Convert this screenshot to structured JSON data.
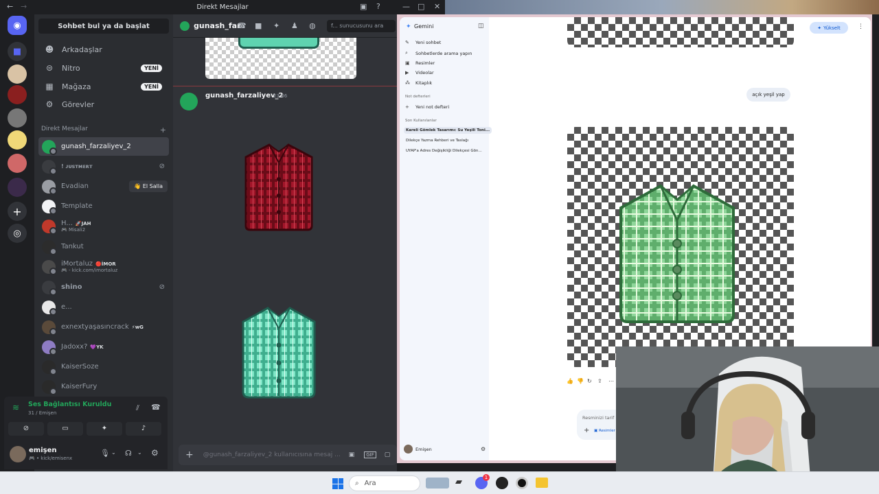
{
  "discord": {
    "window_title": "Direkt Mesajlar",
    "find_conversation": "Sohbet bul ya da başlat",
    "nav": [
      {
        "label": "Arkadaşlar",
        "icon": "friends-icon"
      },
      {
        "label": "Nitro",
        "icon": "nitro-icon",
        "badge": "YENİ"
      },
      {
        "label": "Mağaza",
        "icon": "shop-icon",
        "badge": "YENİ"
      },
      {
        "label": "Görevler",
        "icon": "quests-icon"
      }
    ],
    "dm_header": "Direkt Mesajlar",
    "dm_list": [
      {
        "name": "gunash_farzaliyev_2",
        "color": "#23a55a"
      },
      {
        "name": "! ᴊᴜsᴛᴍᴇʀᴛ",
        "color": "#3a3c40"
      },
      {
        "name": "Evadian",
        "color": "#9a9da3",
        "action": "👋 El Salla"
      },
      {
        "name": "Template",
        "color": "#f2f3f5"
      },
      {
        "name": "H...",
        "tag": "🚀JAH",
        "sub": "🎮 Misali2",
        "color": "#c0392b"
      },
      {
        "name": "Tankut",
        "color": "#2c2c2c"
      },
      {
        "name": "iMortaluz",
        "tag": "🔴İMOR",
        "sub": "🎮 - kick.com/imortaluz",
        "color": "#4a4a4a"
      },
      {
        "name": "shino",
        "color": "#3a3c40"
      },
      {
        "name": "e...",
        "color": "#e8e8e8"
      },
      {
        "name": "exnextyaşasıncrack",
        "tag": "⚡wG",
        "color": "#5a4a3a"
      },
      {
        "name": "Jadoxx?",
        "tag": "💜YK",
        "color": "#8e7cc3"
      },
      {
        "name": "KaiserSoze",
        "color": "#2a2a2a"
      },
      {
        "name": "KaiserFury",
        "color": "#2a2a2a"
      }
    ],
    "voice": {
      "status": "Ses Bağlantısı Kuruldu",
      "server": "31 / Emişen"
    },
    "user": {
      "name": "emişen",
      "status": "🎮 • kick/emisenx"
    },
    "chat": {
      "channel": "gunash_far",
      "search_placeholder": "f... sunucusunu ara",
      "author": "gunash_farzaliyev_2",
      "time": "23:36",
      "input_placeholder": "@gunash_farzaliyev_2 kullanıcısına mesaj ..."
    }
  },
  "gemini": {
    "app_name": "Gemini",
    "upgrade": "Yükselt",
    "nav": [
      {
        "label": "Yeni sohbet",
        "icon": "edit-icon"
      },
      {
        "label": "Sohbetlerde arama yapın",
        "icon": "search-icon"
      },
      {
        "label": "Resimler",
        "icon": "image-icon"
      },
      {
        "label": "Videolar",
        "icon": "video-icon"
      },
      {
        "label": "Kitaplık",
        "icon": "library-icon"
      }
    ],
    "notebooks_header": "Not defterleri",
    "new_notebook": "Yeni not defteri",
    "recent_header": "Son Kullanılanlar",
    "recent": [
      "Kareli Gömlek Tasarımı: Su Yeşili Toni...",
      "Dilekçe Yazma Rehberi ve Taslağı",
      "UYAP'a Adres Değişikliği Dilekçesi Gön..."
    ],
    "user_message": "açık yeşil yap",
    "input_placeholder": "Resminizi tarif",
    "input_chip": "Resimler",
    "account": "Emişen"
  },
  "taskbar": {
    "search": "Ara",
    "notification_count": "1"
  }
}
